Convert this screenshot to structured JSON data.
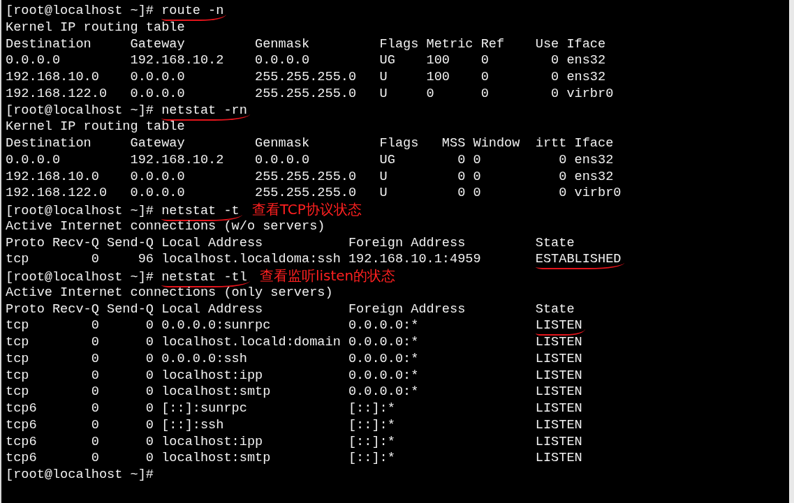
{
  "terminal": {
    "lines": [
      {
        "segments": [
          {
            "kind": "text",
            "text": "[root@localhost ~]# "
          },
          {
            "kind": "text",
            "text": "route -n",
            "underlined": true
          }
        ]
      },
      {
        "segments": [
          {
            "kind": "text",
            "text": "Kernel IP routing table"
          }
        ]
      },
      {
        "segments": [
          {
            "kind": "text",
            "text": "Destination     Gateway         Genmask         Flags Metric Ref    Use Iface"
          }
        ]
      },
      {
        "segments": [
          {
            "kind": "text",
            "text": "0.0.0.0         192.168.10.2    0.0.0.0         UG    100    0        0 ens32"
          }
        ]
      },
      {
        "segments": [
          {
            "kind": "text",
            "text": "192.168.10.0    0.0.0.0         255.255.255.0   U     100    0        0 ens32"
          }
        ]
      },
      {
        "segments": [
          {
            "kind": "text",
            "text": "192.168.122.0   0.0.0.0         255.255.255.0   U     0      0        0 virbr0"
          }
        ]
      },
      {
        "segments": [
          {
            "kind": "text",
            "text": "[root@localhost ~]# "
          },
          {
            "kind": "text",
            "text": "netstat -rn",
            "underlined": true
          }
        ]
      },
      {
        "segments": [
          {
            "kind": "text",
            "text": "Kernel IP routing table"
          }
        ]
      },
      {
        "segments": [
          {
            "kind": "text",
            "text": "Destination     Gateway         Genmask         Flags   MSS Window  irtt Iface"
          }
        ]
      },
      {
        "segments": [
          {
            "kind": "text",
            "text": "0.0.0.0         192.168.10.2    0.0.0.0         UG        0 0          0 ens32"
          }
        ]
      },
      {
        "segments": [
          {
            "kind": "text",
            "text": "192.168.10.0    0.0.0.0         255.255.255.0   U         0 0          0 ens32"
          }
        ]
      },
      {
        "segments": [
          {
            "kind": "text",
            "text": "192.168.122.0   0.0.0.0         255.255.255.0   U         0 0          0 virbr0"
          }
        ]
      },
      {
        "segments": [
          {
            "kind": "text",
            "text": "[root@localhost ~]# "
          },
          {
            "kind": "text",
            "text": "netstat -t",
            "underlined": true
          },
          {
            "kind": "note",
            "text": "查看TCP协议状态"
          }
        ]
      },
      {
        "segments": [
          {
            "kind": "text",
            "text": "Active Internet connections (w/o servers)"
          }
        ]
      },
      {
        "segments": [
          {
            "kind": "text",
            "text": "Proto Recv-Q Send-Q Local Address           Foreign Address         State"
          }
        ]
      },
      {
        "segments": [
          {
            "kind": "text",
            "text": "tcp        0     96 localhost.localdoma:ssh 192.168.10.1:4959       "
          },
          {
            "kind": "text",
            "text": "ESTABLISHED",
            "underlined": true
          }
        ]
      },
      {
        "segments": [
          {
            "kind": "text",
            "text": "[root@localhost ~]# "
          },
          {
            "kind": "text",
            "text": "netstat -tl",
            "underlined": true
          },
          {
            "kind": "note",
            "text": "查看监听listen的状态"
          }
        ]
      },
      {
        "segments": [
          {
            "kind": "text",
            "text": "Active Internet connections (only servers)"
          }
        ]
      },
      {
        "segments": [
          {
            "kind": "text",
            "text": "Proto Recv-Q Send-Q Local Address           Foreign Address         State"
          }
        ]
      },
      {
        "segments": [
          {
            "kind": "text",
            "text": "tcp        0      0 0.0.0.0:sunrpc          0.0.0.0:*               "
          },
          {
            "kind": "text",
            "text": "LISTEN",
            "underlined": true
          }
        ]
      },
      {
        "segments": [
          {
            "kind": "text",
            "text": "tcp        0      0 localhost.locald:domain 0.0.0.0:*               LISTEN"
          }
        ]
      },
      {
        "segments": [
          {
            "kind": "text",
            "text": "tcp        0      0 0.0.0.0:ssh             0.0.0.0:*               LISTEN"
          }
        ]
      },
      {
        "segments": [
          {
            "kind": "text",
            "text": "tcp        0      0 localhost:ipp           0.0.0.0:*               LISTEN"
          }
        ]
      },
      {
        "segments": [
          {
            "kind": "text",
            "text": "tcp        0      0 localhost:smtp          0.0.0.0:*               LISTEN"
          }
        ]
      },
      {
        "segments": [
          {
            "kind": "text",
            "text": "tcp6       0      0 [::]:sunrpc             [::]:*                  LISTEN"
          }
        ]
      },
      {
        "segments": [
          {
            "kind": "text",
            "text": "tcp6       0      0 [::]:ssh                [::]:*                  LISTEN"
          }
        ]
      },
      {
        "segments": [
          {
            "kind": "text",
            "text": "tcp6       0      0 localhost:ipp           [::]:*                  LISTEN"
          }
        ]
      },
      {
        "segments": [
          {
            "kind": "text",
            "text": "tcp6       0      0 localhost:smtp          [::]:*                  LISTEN"
          }
        ]
      },
      {
        "segments": [
          {
            "kind": "text",
            "text": "[root@localhost ~]#"
          }
        ]
      }
    ]
  }
}
